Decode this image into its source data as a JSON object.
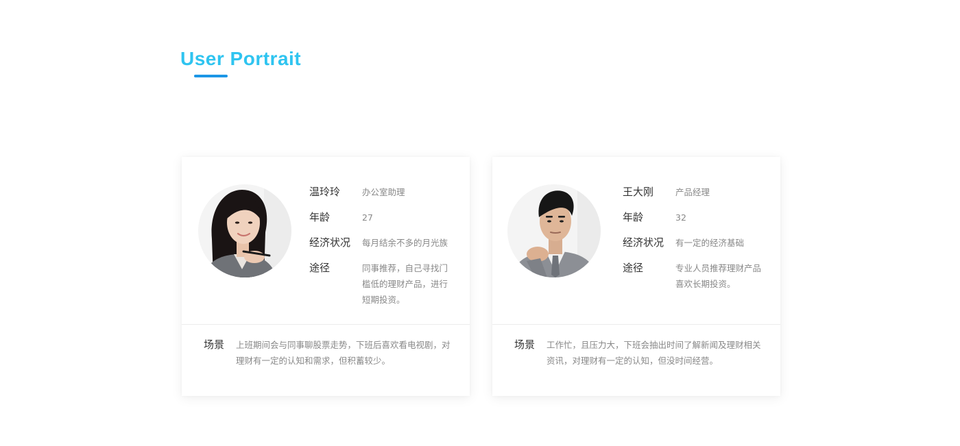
{
  "section": {
    "title": "User Portrait"
  },
  "colors": {
    "title": "#2fc4f0",
    "underline": "#1c96e6",
    "label": "#333333",
    "value": "#888888"
  },
  "personas": [
    {
      "name": "温玲玲",
      "occupation": "办公室助理",
      "age_label": "年龄",
      "age": "27",
      "finance_label": "经济状况",
      "finance": "每月结余不多的月光族",
      "channel_label": "途径",
      "channel": "同事推荐，自己寻找门槛低的理财产品，进行短期投资。",
      "scene_label": "场景",
      "scene": "上班期间会与同事聊股票走势，下班后喜欢看电视剧，对理财有一定的认知和需求，但积蓄较少。",
      "avatar_icon": "woman-portrait"
    },
    {
      "name": "王大刚",
      "occupation": "产品经理",
      "age_label": "年龄",
      "age": "32",
      "finance_label": "经济状况",
      "finance": "有一定的经济基础",
      "channel_label": "途径",
      "channel": "专业人员推荐理财产品喜欢长期投资。",
      "scene_label": "场景",
      "scene": "工作忙，且压力大，下班会抽出时间了解新闻及理财相关资讯，对理财有一定的认知，但没时间经营。",
      "avatar_icon": "man-portrait"
    }
  ]
}
